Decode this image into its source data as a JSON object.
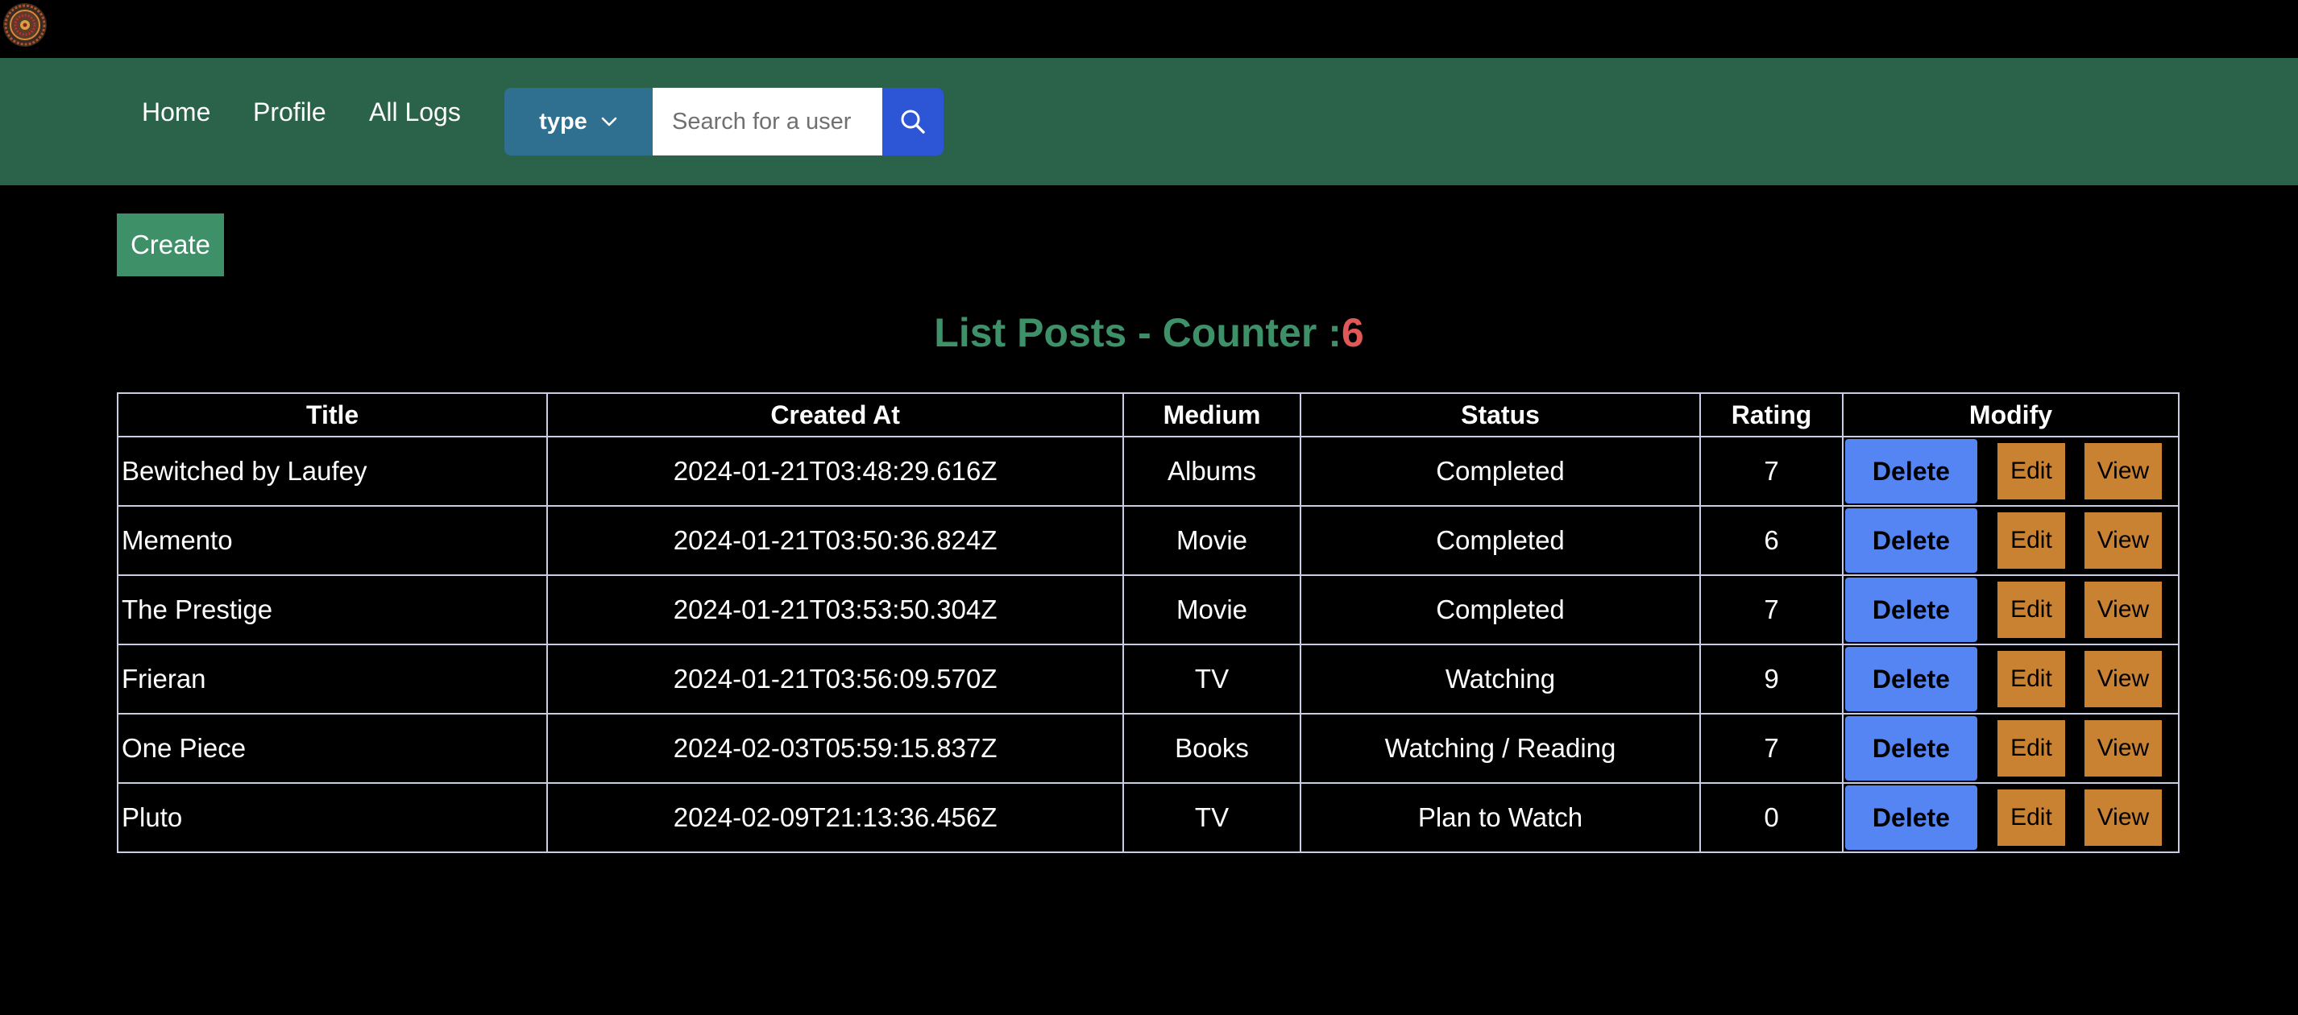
{
  "nav": {
    "home": "Home",
    "profile": "Profile",
    "all_logs": "All Logs"
  },
  "search": {
    "type_label": "type",
    "placeholder": "Search for a user",
    "type_icon": "chevron-down-icon",
    "button_icon": "search-icon"
  },
  "create_label": "Create",
  "list": {
    "title": "List Posts - Counter :",
    "count": "6"
  },
  "table": {
    "headers": [
      "Title",
      "Created At",
      "Medium",
      "Status",
      "Rating",
      "Modify"
    ],
    "rows": [
      {
        "title": "Bewitched by Laufey",
        "created_at": "2024-01-21T03:48:29.616Z",
        "medium": "Albums",
        "status": "Completed",
        "rating": "7"
      },
      {
        "title": "Memento",
        "created_at": "2024-01-21T03:50:36.824Z",
        "medium": "Movie",
        "status": "Completed",
        "rating": "6"
      },
      {
        "title": "The Prestige",
        "created_at": "2024-01-21T03:53:50.304Z",
        "medium": "Movie",
        "status": "Completed",
        "rating": "7"
      },
      {
        "title": "Frieran",
        "created_at": "2024-01-21T03:56:09.570Z",
        "medium": "TV",
        "status": "Watching",
        "rating": "9"
      },
      {
        "title": "One Piece",
        "created_at": "2024-02-03T05:59:15.837Z",
        "medium": "Books",
        "status": "Watching / Reading",
        "rating": "7"
      },
      {
        "title": "Pluto",
        "created_at": "2024-02-09T21:13:36.456Z",
        "medium": "TV",
        "status": "Plan to Watch",
        "rating": "0"
      }
    ],
    "actions": {
      "delete": "Delete",
      "edit": "Edit",
      "view": "View"
    }
  },
  "colors": {
    "navbar": "#2b624a",
    "accent_green": "#3e9068",
    "counter_red": "#e05858",
    "delete_blue": "#5585f2",
    "action_orange": "#c98132",
    "search_blue": "#2d56d6",
    "type_blue": "#2f6f8f"
  }
}
